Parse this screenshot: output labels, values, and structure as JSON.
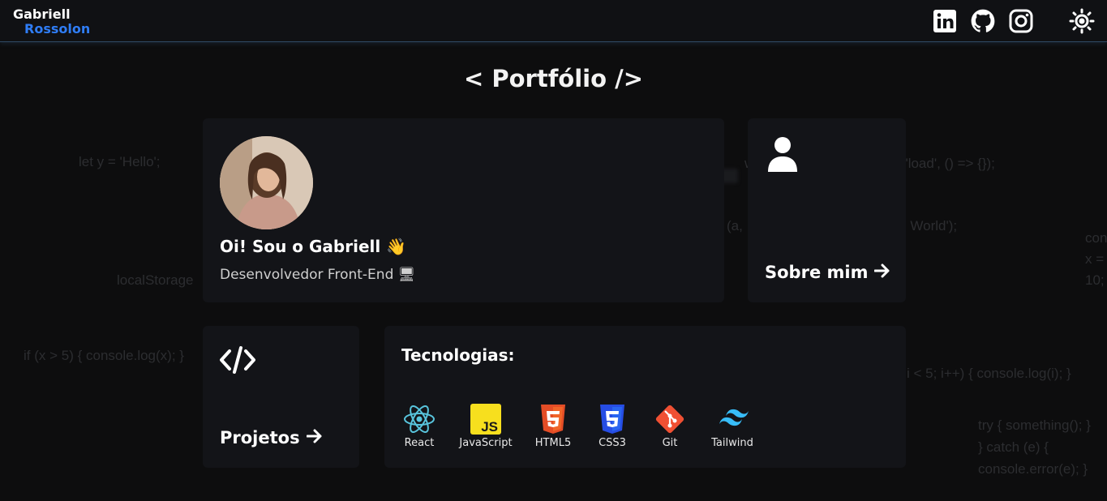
{
  "header": {
    "logo_first": "Gabriell",
    "logo_last": "Rossolon",
    "icons": [
      "linkedin-icon",
      "github-icon",
      "instagram-icon",
      "sun-icon"
    ]
  },
  "background_code": [
    "let y = 'Hello';",
    "localStorage",
    "if (x > 5) { console.log(x); }",
    "window.addEventListener('load', () => {});",
    "(a,",
    "('Hello World');",
    "i < 5; i++) { console.log(i); }",
    "try { something(); }",
    "} catch (e) {",
    "console.error(e); }",
    "con",
    "x =",
    "10;"
  ],
  "main": {
    "title": "< Portfólio />",
    "profile": {
      "greeting": "Oi! Sou o Gabriell 👋",
      "role": "Desenvolvedor Front-End 🖥"
    },
    "about": {
      "label": "Sobre mim"
    },
    "projects": {
      "label": "Projetos"
    },
    "technologies": {
      "title": "Tecnologias:",
      "items": [
        {
          "label": "React",
          "icon": "react-icon",
          "color": "#58c4dc"
        },
        {
          "label": "JavaScript",
          "icon": "javascript-icon",
          "color": "#f7df1e"
        },
        {
          "label": "HTML5",
          "icon": "html5-icon",
          "color": "#e44d26"
        },
        {
          "label": "CSS3",
          "icon": "css3-icon",
          "color": "#264de4"
        },
        {
          "label": "Git",
          "icon": "git-icon",
          "color": "#f05033"
        },
        {
          "label": "Tailwind",
          "icon": "tailwind-icon",
          "color": "#38bdf8"
        }
      ]
    }
  },
  "colors": {
    "background": "#0d0d0e",
    "card": "#131418",
    "accent": "#2f7df6"
  }
}
